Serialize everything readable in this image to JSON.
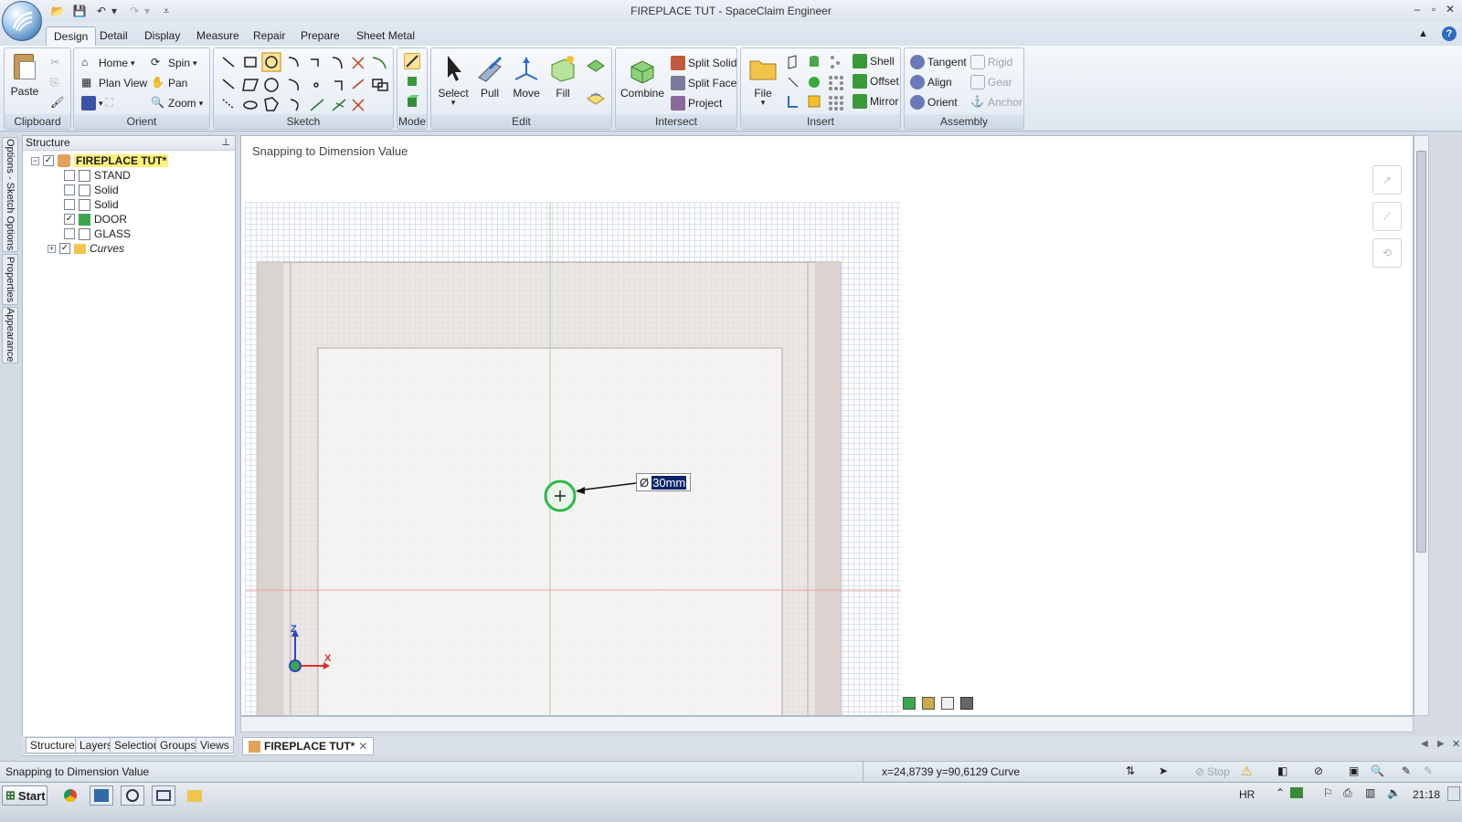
{
  "window": {
    "title": "FIREPLACE TUT - SpaceClaim Engineer",
    "controls": [
      "–",
      "▫",
      "✕"
    ]
  },
  "tabs": [
    {
      "label": "Design",
      "active": true
    },
    {
      "label": "Detail"
    },
    {
      "label": "Display"
    },
    {
      "label": "Measure"
    },
    {
      "label": "Repair"
    },
    {
      "label": "Prepare"
    },
    {
      "label": "Sheet Metal"
    }
  ],
  "ribbon": {
    "clipboard": {
      "label": "Clipboard",
      "paste": "Paste"
    },
    "orient": {
      "label": "Orient",
      "home": "Home",
      "spin": "Spin",
      "plan_view": "Plan View",
      "pan": "Pan",
      "zoom": "Zoom"
    },
    "sketch": {
      "label": "Sketch"
    },
    "mode": {
      "label": "Mode"
    },
    "edit": {
      "label": "Edit",
      "select": "Select",
      "pull": "Pull",
      "move": "Move",
      "fill": "Fill"
    },
    "intersect": {
      "label": "Intersect",
      "combine": "Combine",
      "split_solid": "Split Solid",
      "split_face": "Split Face",
      "project": "Project"
    },
    "insert": {
      "label": "Insert",
      "file": "File",
      "shell": "Shell",
      "offset": "Offset",
      "mirror": "Mirror"
    },
    "assembly": {
      "label": "Assembly",
      "tangent": "Tangent",
      "align": "Align",
      "orient": "Orient",
      "rigid": "Rigid",
      "gear": "Gear",
      "anchor": "Anchor"
    }
  },
  "side_tabs": [
    "Options - Sketch Options",
    "Properties",
    "Appearance"
  ],
  "structure": {
    "title": "Structure",
    "items": [
      {
        "name": "FIREPLACE TUT*",
        "checked": true,
        "root": true
      },
      {
        "name": "STAND",
        "checked": false
      },
      {
        "name": "Solid",
        "checked": false
      },
      {
        "name": "Solid",
        "checked": false
      },
      {
        "name": "DOOR",
        "checked": true
      },
      {
        "name": "GLASS",
        "checked": false
      },
      {
        "name": "Curves",
        "checked": true,
        "italic": true
      }
    ],
    "bottom_tabs": [
      "Structure",
      "Layers",
      "Selection",
      "Groups",
      "Views"
    ]
  },
  "viewport": {
    "hint": "Snapping to Dimension Value",
    "dimension_symbol": "Ø",
    "dimension_value": "30mm",
    "axis_x": "X",
    "axis_z": "Z"
  },
  "document_tab": "FIREPLACE TUT*",
  "status": {
    "message": "Snapping to Dimension Value",
    "coords": "x=24,8739  y=90,6129",
    "mode": "Curve",
    "stop": "Stop"
  },
  "taskbar": {
    "start": "Start",
    "lang": "HR",
    "time": "21:18"
  },
  "colors": {
    "ribbon_selected": "#fbe39c",
    "fireplace_frame": "#e6dfdc",
    "circle_green": "#2fb84a",
    "axis_red": "#e0302a"
  }
}
